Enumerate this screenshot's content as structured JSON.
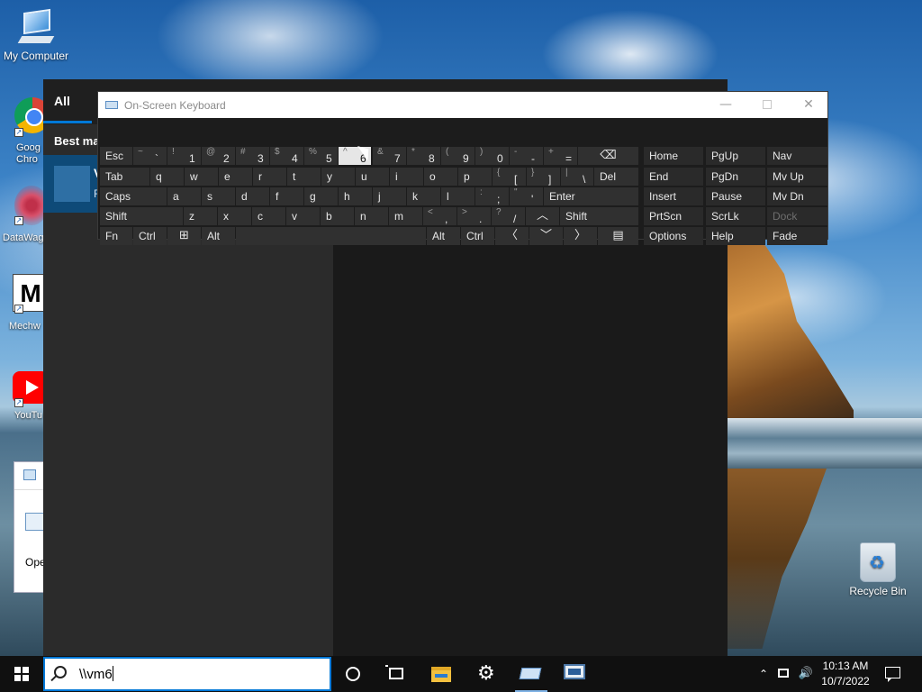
{
  "desktop": {
    "icons": {
      "my_computer": "My Computer",
      "recycle_bin": "Recycle Bin"
    },
    "partial_icons": {
      "chrome": "Goog\nChro",
      "datawag": "DataWag",
      "mech": "Mechw",
      "mech_glyph": "M",
      "youtube": "YouTu"
    },
    "partial_window_text": "Ope"
  },
  "search_panel": {
    "tab_all": "All",
    "best_match": "Best ma",
    "best_card_title": "V",
    "best_card_sub": "R"
  },
  "osk": {
    "title": "On-Screen Keyboard",
    "controls": {
      "minimize": "—",
      "close": "✕"
    },
    "rows": [
      [
        {
          "id": "esc",
          "label": "Esc"
        },
        {
          "id": "tilde",
          "shift": "~",
          "main": "`"
        },
        {
          "id": "k1",
          "shift": "!",
          "main": "1"
        },
        {
          "id": "k2",
          "shift": "@",
          "main": "2"
        },
        {
          "id": "k3",
          "shift": "#",
          "main": "3"
        },
        {
          "id": "k4",
          "shift": "$",
          "main": "4"
        },
        {
          "id": "k5",
          "shift": "%",
          "main": "5"
        },
        {
          "id": "k6",
          "shift": "^",
          "main": "6"
        },
        {
          "id": "k7",
          "shift": "&",
          "main": "7"
        },
        {
          "id": "k8",
          "shift": "*",
          "main": "8"
        },
        {
          "id": "k9",
          "shift": "(",
          "main": "9"
        },
        {
          "id": "k0",
          "shift": ")",
          "main": "0"
        },
        {
          "id": "minus",
          "shift": "-",
          "main": "-"
        },
        {
          "id": "equals",
          "shift": "+",
          "main": "="
        },
        {
          "id": "backspace",
          "label": "⌫"
        }
      ],
      [
        {
          "id": "tab",
          "label": "Tab"
        },
        {
          "id": "q",
          "label": "q"
        },
        {
          "id": "w",
          "label": "w"
        },
        {
          "id": "e",
          "label": "e"
        },
        {
          "id": "r",
          "label": "r"
        },
        {
          "id": "t",
          "label": "t"
        },
        {
          "id": "y",
          "label": "y"
        },
        {
          "id": "u",
          "label": "u"
        },
        {
          "id": "i",
          "label": "i"
        },
        {
          "id": "o",
          "label": "o"
        },
        {
          "id": "p",
          "label": "p"
        },
        {
          "id": "lbracket",
          "shift": "{",
          "main": "["
        },
        {
          "id": "rbracket",
          "shift": "}",
          "main": "]"
        },
        {
          "id": "backslash",
          "shift": "|",
          "main": "\\"
        },
        {
          "id": "del",
          "label": "Del"
        }
      ],
      [
        {
          "id": "caps",
          "label": "Caps"
        },
        {
          "id": "a",
          "label": "a"
        },
        {
          "id": "s",
          "label": "s"
        },
        {
          "id": "d",
          "label": "d"
        },
        {
          "id": "f",
          "label": "f"
        },
        {
          "id": "g",
          "label": "g"
        },
        {
          "id": "h",
          "label": "h"
        },
        {
          "id": "j",
          "label": "j"
        },
        {
          "id": "k",
          "label": "k"
        },
        {
          "id": "l",
          "label": "l"
        },
        {
          "id": "semicolon",
          "shift": ":",
          "main": ";"
        },
        {
          "id": "quote",
          "shift": "\"",
          "main": "'"
        },
        {
          "id": "enter",
          "label": "Enter"
        }
      ],
      [
        {
          "id": "lshift",
          "label": "Shift"
        },
        {
          "id": "z",
          "label": "z"
        },
        {
          "id": "x",
          "label": "x"
        },
        {
          "id": "c",
          "label": "c"
        },
        {
          "id": "v",
          "label": "v"
        },
        {
          "id": "b",
          "label": "b"
        },
        {
          "id": "n",
          "label": "n"
        },
        {
          "id": "m",
          "label": "m"
        },
        {
          "id": "comma",
          "shift": "<",
          "main": ","
        },
        {
          "id": "period",
          "shift": ">",
          "main": "."
        },
        {
          "id": "slash",
          "shift": "?",
          "main": "/"
        },
        {
          "id": "up",
          "label": "︿"
        },
        {
          "id": "rshift",
          "label": "Shift"
        }
      ],
      [
        {
          "id": "fn",
          "label": "Fn"
        },
        {
          "id": "lctrl",
          "label": "Ctrl"
        },
        {
          "id": "win",
          "label": "⊞"
        },
        {
          "id": "lalt",
          "label": "Alt"
        },
        {
          "id": "space",
          "label": ""
        },
        {
          "id": "ralt",
          "label": "Alt"
        },
        {
          "id": "rctrl",
          "label": "Ctrl"
        },
        {
          "id": "left",
          "label": "〈"
        },
        {
          "id": "down",
          "label": "﹀"
        },
        {
          "id": "right",
          "label": "〉"
        },
        {
          "id": "menu",
          "label": "▤"
        }
      ]
    ],
    "nav_keys": [
      [
        "Home",
        "PgUp",
        "Nav"
      ],
      [
        "End",
        "PgDn",
        "Mv Up"
      ],
      [
        "Insert",
        "Pause",
        "Mv Dn"
      ],
      [
        "PrtScn",
        "ScrLk",
        "Dock"
      ],
      [
        "Options",
        "Help",
        "Fade"
      ]
    ],
    "pressed_key": "k6",
    "dimmed_key": "Dock"
  },
  "taskbar": {
    "search_value": "\\\\vm6",
    "clock_time": "10:13 AM",
    "clock_date": "10/7/2022",
    "tray_up": "⌃",
    "tray_volume": "🔊",
    "settings_glyph": "⚙"
  }
}
